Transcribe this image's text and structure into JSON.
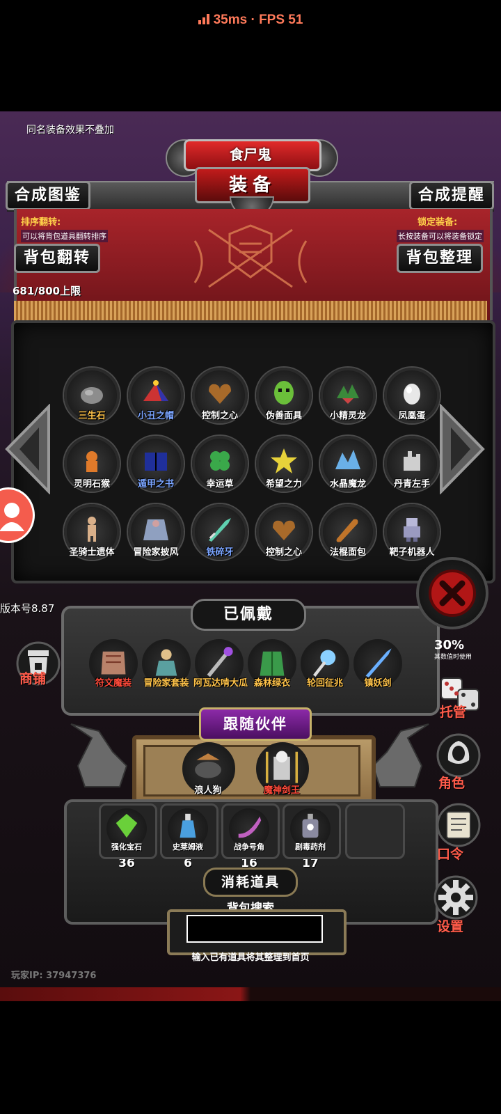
{
  "status": {
    "ping": "35ms",
    "separator": " · ",
    "fps": "FPS 51"
  },
  "notes": {
    "same_name": "同名装备效果不叠加",
    "sort_title": "排序翻转:",
    "sort_desc": "可以将背包道具翻转排序",
    "lock_title": "锁定装备:",
    "lock_desc": "长按装备可以将装备锁定",
    "capacity": "681/800上限",
    "version": "版本号8.87",
    "player_ip": "玩家IP: 37947376"
  },
  "header": {
    "top_title": "食尸鬼",
    "title": "装备"
  },
  "buttons": {
    "codex": "合成图鉴",
    "reminder": "合成提醒",
    "flip": "背包翻转",
    "organize": "背包整理"
  },
  "inventory": [
    {
      "name": "三生石",
      "color": "#ffc34a",
      "icon": "stone-icon"
    },
    {
      "name": "小丑之帽",
      "color": "#7aa4ff",
      "icon": "jester-hat-icon"
    },
    {
      "name": "控制之心",
      "color": "#ffffff",
      "icon": "heart-icon"
    },
    {
      "name": "伪善面具",
      "color": "#ffffff",
      "icon": "mask-icon"
    },
    {
      "name": "小精灵龙",
      "color": "#ffffff",
      "icon": "dragon-icon"
    },
    {
      "name": "凤凰蛋",
      "color": "#ffffff",
      "icon": "egg-icon"
    },
    {
      "name": "灵明石猴",
      "color": "#ffffff",
      "icon": "monkey-icon"
    },
    {
      "name": "遁甲之书",
      "color": "#7aa4ff",
      "icon": "book-icon"
    },
    {
      "name": "幸运草",
      "color": "#ffffff",
      "icon": "clover-icon"
    },
    {
      "name": "希望之力",
      "color": "#ffffff",
      "icon": "star-icon"
    },
    {
      "name": "水晶魔龙",
      "color": "#ffffff",
      "icon": "crystal-dragon-icon"
    },
    {
      "name": "丹青左手",
      "color": "#ffffff",
      "icon": "hand-icon"
    },
    {
      "name": "圣骑士遗体",
      "color": "#ffffff",
      "icon": "remains-icon"
    },
    {
      "name": "冒险家披风",
      "color": "#ffffff",
      "icon": "cloak-icon"
    },
    {
      "name": "铁碎牙",
      "color": "#7aa4ff",
      "icon": "sword-icon"
    },
    {
      "name": "控制之心",
      "color": "#ffffff",
      "icon": "heart-icon"
    },
    {
      "name": "法棍面包",
      "color": "#ffffff",
      "icon": "bread-icon"
    },
    {
      "name": "靶子机器人",
      "color": "#ffffff",
      "icon": "robot-icon"
    }
  ],
  "shop_label": "商铺",
  "equipped": {
    "title": "已佩戴",
    "items": [
      {
        "name": "符文魔装",
        "color": "#ff4a3a",
        "icon": "rune-armor-icon"
      },
      {
        "name": "冒险家套装",
        "color": "#ffc34a",
        "icon": "adventurer-icon"
      },
      {
        "name": "阿瓦达啃大瓜",
        "color": "#ffc34a",
        "icon": "staff-icon"
      },
      {
        "name": "森林绿衣",
        "color": "#ffc34a",
        "icon": "green-cloak-icon"
      },
      {
        "name": "轮回征兆",
        "color": "#ffc34a",
        "icon": "ice-orb-icon"
      },
      {
        "name": "镇妖剑",
        "color": "#ffc34a",
        "icon": "blue-sword-icon"
      }
    ]
  },
  "companion": {
    "title": "跟随伙伴",
    "items": [
      {
        "name": "浪人狗",
        "color": "#ffffff",
        "icon": "ronin-dog-icon"
      },
      {
        "name": "魔神剑王",
        "color": "#ff4a3a",
        "icon": "sword-king-icon"
      }
    ]
  },
  "consumables": {
    "title": "消耗道具",
    "items": [
      {
        "name": "强化宝石",
        "count": "36",
        "icon": "gem-icon"
      },
      {
        "name": "史莱姆液",
        "count": "6",
        "icon": "potion-icon"
      },
      {
        "name": "战争号角",
        "count": "16",
        "icon": "horn-icon"
      },
      {
        "name": "剧毒药剂",
        "count": "17",
        "icon": "poison-icon"
      }
    ]
  },
  "search": {
    "label": "背包搜索",
    "value": "",
    "hint": "输入已有道具将其整理到首页"
  },
  "right_menu": {
    "stat_value": "30%",
    "stat_note": "其数值时使用",
    "manage": "托管",
    "role": "角色",
    "command": "口令",
    "settings": "设置"
  },
  "colors": {
    "accent": "#ff5b4a",
    "gold": "#ffc34a",
    "blue": "#7aa4ff",
    "curtain": "#a8242a"
  }
}
